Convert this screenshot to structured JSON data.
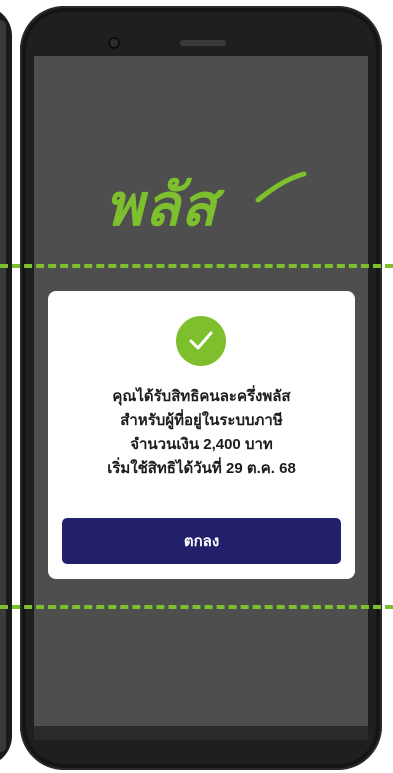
{
  "brand": {
    "text": "พลัส",
    "color": "#7dbf2c"
  },
  "dialog": {
    "icon": "check-circle-icon",
    "lines": [
      "คุณได้รับสิทธิคนละครึ่งพลัส",
      "สำหรับผู้ที่อยู่ในระบบภาษี",
      "จำนวนเงิน 2,400 บาท",
      "เริ่มใช้สิทธิได้วันที่ 29 ต.ค. 68"
    ],
    "ok_label": "ตกลง"
  },
  "colors": {
    "accent": "#7dbf2c",
    "button": "#23206b",
    "screen": "#4e4e4e",
    "frame": "#151515"
  }
}
